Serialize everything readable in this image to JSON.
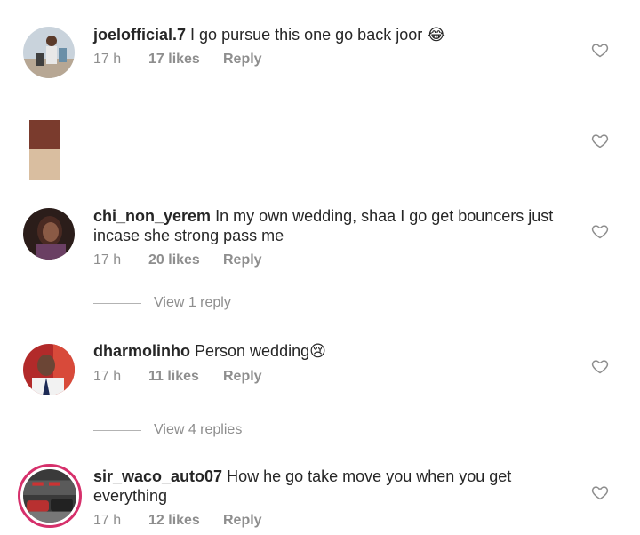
{
  "comments": [
    {
      "username": "joelofficial.7",
      "text": "I go pursue this one go back joor",
      "emoji": "😂",
      "time": "17 h",
      "likes": "17 likes",
      "reply": "Reply"
    },
    {
      "username": "chi_non_yerem",
      "text": "In my own wedding, shaa I go get bouncers just incase she strong pass me",
      "time": "17 h",
      "likes": "20 likes",
      "reply": "Reply",
      "view_replies": "View 1 reply"
    },
    {
      "username": "dharmolinho",
      "text": "Person wedding",
      "emoji": "😢",
      "time": "17 h",
      "likes": "11 likes",
      "reply": "Reply",
      "view_replies": "View 4 replies"
    },
    {
      "username": "sir_waco_auto07",
      "text": "How he go take move you when you get everything",
      "time": "17 h",
      "likes": "12 likes",
      "reply": "Reply"
    }
  ],
  "colors": {
    "text": "#262626",
    "meta": "#8e8e8e",
    "story_ring": "#d6306b",
    "media_top": "#7a3b2d",
    "media_bottom": "#d9bea0"
  },
  "icons": {
    "like": "heart-outline-icon"
  }
}
